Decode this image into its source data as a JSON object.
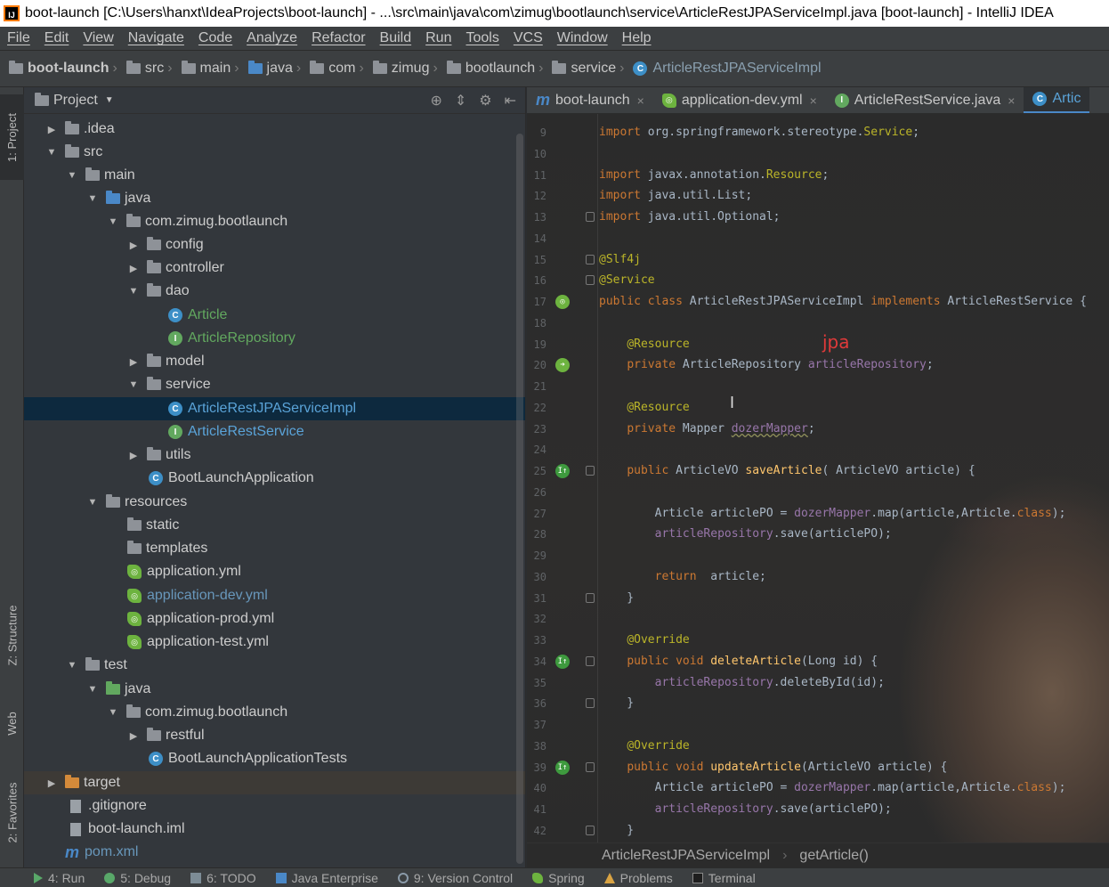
{
  "window": {
    "title": "boot-launch [C:\\Users\\hanxt\\IdeaProjects\\boot-launch] - ...\\src\\main\\java\\com\\zimug\\bootlaunch\\service\\ArticleRestJPAServiceImpl.java [boot-launch] - IntelliJ IDEA"
  },
  "menu": [
    "File",
    "Edit",
    "View",
    "Navigate",
    "Code",
    "Analyze",
    "Refactor",
    "Build",
    "Run",
    "Tools",
    "VCS",
    "Window",
    "Help"
  ],
  "breadcrumb": [
    "boot-launch",
    "src",
    "main",
    "java",
    "com",
    "zimug",
    "bootlaunch",
    "service",
    "ArticleRestJPAServiceImpl"
  ],
  "left_stripe": {
    "project": "1: Project",
    "structure": "Z: Structure",
    "web": "Web",
    "favorites": "2: Favorites"
  },
  "project_panel": {
    "title": "Project",
    "tree": [
      {
        "label": ".idea",
        "arrow": "▶"
      },
      {
        "label": "src",
        "arrow": "▼"
      },
      {
        "label": "main",
        "arrow": "▼"
      },
      {
        "label": "java",
        "arrow": "▼"
      },
      {
        "label": "com.zimug.bootlaunch",
        "arrow": "▼"
      },
      {
        "label": "config",
        "arrow": "▶"
      },
      {
        "label": "controller",
        "arrow": "▶"
      },
      {
        "label": "dao",
        "arrow": "▼"
      },
      {
        "label": "Article",
        "arrow": ""
      },
      {
        "label": "ArticleRepository",
        "arrow": ""
      },
      {
        "label": "model",
        "arrow": "▶"
      },
      {
        "label": "service",
        "arrow": "▼"
      },
      {
        "label": "ArticleRestJPAServiceImpl",
        "arrow": ""
      },
      {
        "label": "ArticleRestService",
        "arrow": ""
      },
      {
        "label": "utils",
        "arrow": "▶"
      },
      {
        "label": "BootLaunchApplication",
        "arrow": ""
      },
      {
        "label": "resources",
        "arrow": "▼"
      },
      {
        "label": "static",
        "arrow": ""
      },
      {
        "label": "templates",
        "arrow": ""
      },
      {
        "label": "application.yml",
        "arrow": ""
      },
      {
        "label": "application-dev.yml",
        "arrow": ""
      },
      {
        "label": "application-prod.yml",
        "arrow": ""
      },
      {
        "label": "application-test.yml",
        "arrow": ""
      },
      {
        "label": "test",
        "arrow": "▼"
      },
      {
        "label": "java",
        "arrow": "▼"
      },
      {
        "label": "com.zimug.bootlaunch",
        "arrow": "▼"
      },
      {
        "label": "restful",
        "arrow": "▶"
      },
      {
        "label": "BootLaunchApplicationTests",
        "arrow": ""
      },
      {
        "label": "target",
        "arrow": "▶"
      },
      {
        "label": ".gitignore",
        "arrow": ""
      },
      {
        "label": "boot-launch.iml",
        "arrow": ""
      },
      {
        "label": "pom.xml",
        "arrow": ""
      }
    ]
  },
  "editor_tabs": [
    {
      "label": "boot-launch",
      "icon": "maven-icon"
    },
    {
      "label": "application-dev.yml",
      "icon": "spring-icon"
    },
    {
      "label": "ArticleRestService.java",
      "icon": "interface-icon"
    },
    {
      "label": "Artic",
      "icon": "class-icon"
    }
  ],
  "code": [
    {
      "n": "9",
      "t": "import org.springframework.stereotype.Service;"
    },
    {
      "n": "10",
      "t": ""
    },
    {
      "n": "11",
      "t": "import javax.annotation.Resource;"
    },
    {
      "n": "12",
      "t": "import java.util.List;"
    },
    {
      "n": "13",
      "t": "import java.util.Optional;"
    },
    {
      "n": "14",
      "t": ""
    },
    {
      "n": "15",
      "t": "@Slf4j"
    },
    {
      "n": "16",
      "t": "@Service"
    },
    {
      "n": "17",
      "t": "public class ArticleRestJPAServiceImpl implements ArticleRestService {"
    },
    {
      "n": "18",
      "t": ""
    },
    {
      "n": "19",
      "t": "    @Resource"
    },
    {
      "n": "20",
      "t": "    private ArticleRepository articleRepository;"
    },
    {
      "n": "21",
      "t": ""
    },
    {
      "n": "22",
      "t": "    @Resource"
    },
    {
      "n": "23",
      "t": "    private Mapper dozerMapper;"
    },
    {
      "n": "24",
      "t": ""
    },
    {
      "n": "25",
      "t": "    public ArticleVO saveArticle( ArticleVO article) {"
    },
    {
      "n": "26",
      "t": ""
    },
    {
      "n": "27",
      "t": "        Article articlePO = dozerMapper.map(article,Article.class);"
    },
    {
      "n": "28",
      "t": "        articleRepository.save(articlePO);"
    },
    {
      "n": "29",
      "t": ""
    },
    {
      "n": "30",
      "t": "        return  article;"
    },
    {
      "n": "31",
      "t": "    }"
    },
    {
      "n": "32",
      "t": ""
    },
    {
      "n": "33",
      "t": "    @Override"
    },
    {
      "n": "34",
      "t": "    public void deleteArticle(Long id) {"
    },
    {
      "n": "35",
      "t": "        articleRepository.deleteById(id);"
    },
    {
      "n": "36",
      "t": "    }"
    },
    {
      "n": "37",
      "t": ""
    },
    {
      "n": "38",
      "t": "    @Override"
    },
    {
      "n": "39",
      "t": "    public void updateArticle(ArticleVO article) {"
    },
    {
      "n": "40",
      "t": "        Article articlePO = dozerMapper.map(article,Article.class);"
    },
    {
      "n": "41",
      "t": "        articleRepository.save(articlePO);"
    },
    {
      "n": "42",
      "t": "    }"
    }
  ],
  "annotation_note": "jpa",
  "editor_breadcrumb": [
    "ArticleRestJPAServiceImpl",
    "getArticle()"
  ],
  "bottom_tools": [
    "4: Run",
    "5: Debug",
    "6: TODO",
    "Java Enterprise",
    "9: Version Control",
    "Spring",
    "Problems",
    "Terminal"
  ],
  "colors": {
    "keyword": "#cc7832",
    "annotation": "#bbb529",
    "field": "#9876aa",
    "method": "#ffc66d",
    "accent": "#4a88c7",
    "note": "#e03a3a"
  }
}
